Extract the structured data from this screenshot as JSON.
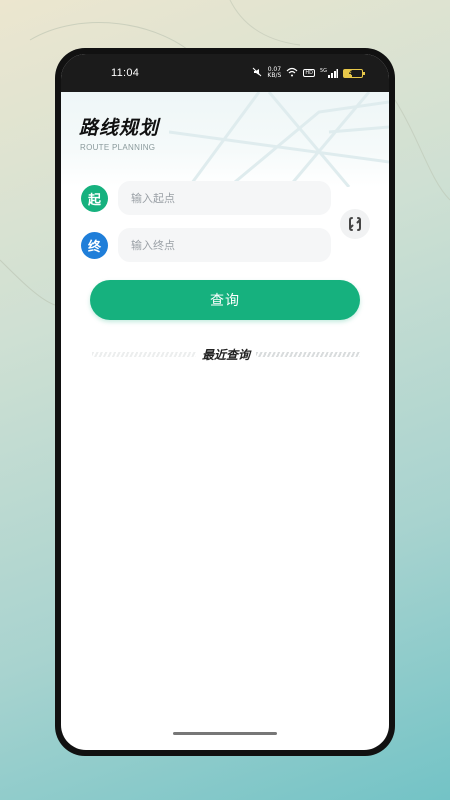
{
  "status_bar": {
    "time": "11:04",
    "net_speed_value": "0.07",
    "net_speed_unit": "KB/S",
    "hd_label": "HD",
    "signal_label": "5G",
    "battery_level": "44"
  },
  "header": {
    "title": "路线规划",
    "subtitle": "ROUTE PLANNING"
  },
  "route": {
    "start_badge": "起",
    "start_placeholder": "输入起点",
    "start_value": "",
    "end_badge": "终",
    "end_placeholder": "输入终点",
    "end_value": ""
  },
  "actions": {
    "query_label": "查询"
  },
  "recent": {
    "title": "最近查询"
  },
  "icons": {
    "swap": "swap-icon",
    "mute": "mute-icon",
    "wifi": "wifi-icon",
    "signal": "signal-icon",
    "battery": "battery-icon"
  },
  "colors": {
    "accent_green": "#16b17e",
    "accent_blue": "#1f7ed9"
  }
}
